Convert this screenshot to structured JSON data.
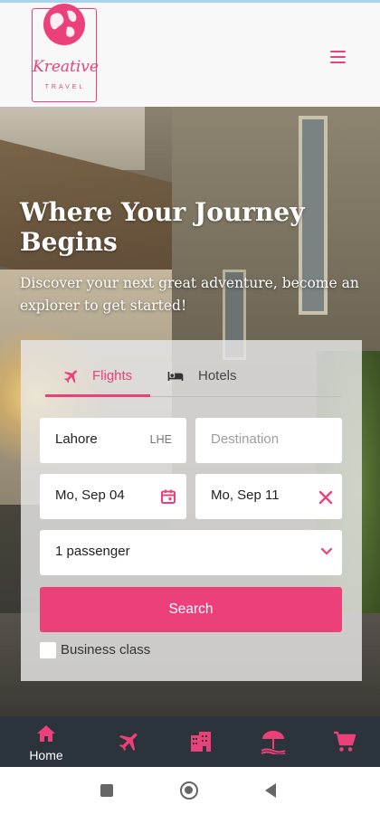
{
  "brand": {
    "script": "Kreative",
    "sub": "TRAVEL"
  },
  "hero": {
    "title": "Where Your Journey Begins",
    "subtitle": "Discover your next great adventure, become an explorer to get started!"
  },
  "search_panel": {
    "tabs": [
      {
        "label": "Flights",
        "icon": "airplane-icon",
        "active": true
      },
      {
        "label": "Hotels",
        "icon": "bed-icon",
        "active": false
      }
    ],
    "origin": {
      "value": "Lahore",
      "code": "LHE"
    },
    "destination": {
      "placeholder": "Destination"
    },
    "depart_date": "Mo, Sep 04",
    "return_date": "Mo, Sep 11",
    "passengers": "1 passenger",
    "search_label": "Search",
    "business_class_label": "Business class"
  },
  "bottom_nav": {
    "items": [
      {
        "label": "Home",
        "icon": "home-icon"
      },
      {
        "label": "",
        "icon": "airplane-icon"
      },
      {
        "label": "",
        "icon": "hotel-building-icon"
      },
      {
        "label": "",
        "icon": "beach-umbrella-icon"
      },
      {
        "label": "",
        "icon": "cart-icon"
      }
    ]
  },
  "colors": {
    "accent": "#ec407a",
    "nav_bg": "#2b333b"
  }
}
